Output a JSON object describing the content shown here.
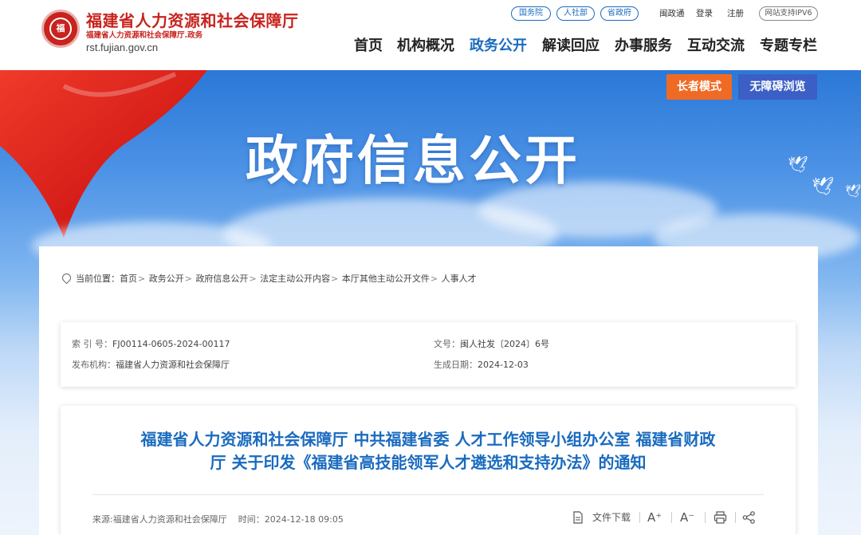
{
  "header": {
    "site_title": "福建省人力资源和社会保障厅",
    "site_subtitle": "福建省人力资源和社会保障厅.政务",
    "site_domain": "rst.fujian.gov.cn",
    "emblem_text": "福",
    "top_pills": [
      "国务院",
      "人社部",
      "省政府"
    ],
    "top_links": [
      "闽政通",
      "登录",
      "注册"
    ],
    "ipv6": "网站支持IPV6"
  },
  "nav": {
    "items": [
      "首页",
      "机构概况",
      "政务公开",
      "解读回应",
      "办事服务",
      "互动交流",
      "专题专栏"
    ],
    "active_index": 2
  },
  "banner": {
    "title": "政府信息公开",
    "elder_mode": "长者模式",
    "accessible": "无障碍浏览"
  },
  "breadcrumb": {
    "prefix": "当前位置：",
    "items": [
      "首页",
      "政务公开",
      "政府信息公开",
      "法定主动公开内容",
      "本厅其他主动公开文件",
      "人事人才"
    ],
    "separator": ">"
  },
  "meta": {
    "index_label": "索 引 号：",
    "index_value": "FJ00114-0605-2024-00117",
    "doc_no_label": "文号：",
    "doc_no_value": "闽人社发〔2024〕6号",
    "issuer_label": "发布机构：",
    "issuer_value": "福建省人力资源和社会保障厅",
    "date_label": "生成日期：",
    "date_value": "2024-12-03"
  },
  "article": {
    "title_line1": "福建省人力资源和社会保障厅 中共福建省委 人才工作领导小组办公室 福建省财政",
    "title_line2": "厅 关于印发《福建省高技能领军人才遴选和支持办法》的通知",
    "source": "来源:福建省人力资源和社会保障厅",
    "time_label": "时间：",
    "time_value": "2024-12-18 09:05",
    "download": "文件下载",
    "font_up": "A⁺",
    "font_down": "A⁻"
  },
  "colors": {
    "brand_red": "#c8231e",
    "link_blue": "#1a6bbf",
    "elder_orange": "#f06a24",
    "access_blue": "#3b5fc4"
  }
}
